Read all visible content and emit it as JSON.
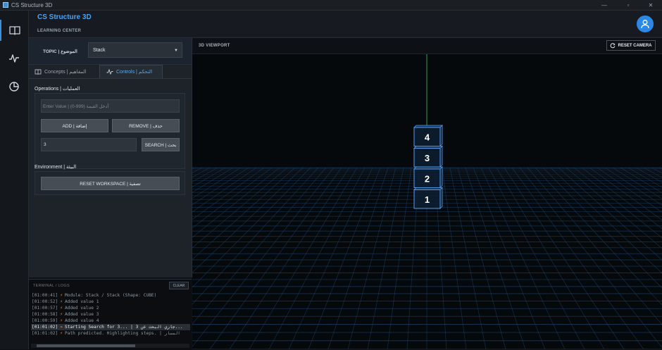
{
  "window": {
    "title": "CS Structure 3D"
  },
  "header": {
    "title": "CS Structure 3D",
    "subtitle": "LEARNING CENTER"
  },
  "rail": {
    "icons": [
      "book-icon",
      "pulse-icon",
      "pie-chart-icon"
    ]
  },
  "topic": {
    "label": "TOPIC | الموضوع",
    "selected": "Stack"
  },
  "tabs": [
    {
      "label": "Concepts | المفاهيم",
      "active": false
    },
    {
      "label": "Controls | التحكم",
      "active": true
    }
  ],
  "operations": {
    "title": "Operations | العمليات",
    "value_placeholder": "Enter Value | (0-999) أدخل القيمة",
    "add_label": "ADD | إضافة",
    "remove_label": "REMOVE | حذف",
    "search_value": "3",
    "search_label": "SEARCH | بحث"
  },
  "environment": {
    "title": "Environment | البيئة",
    "reset_label": "RESET WORKSPACE | تصفية"
  },
  "terminal": {
    "title": "TERMINAL / LOGS",
    "clear_label": "CLEAR",
    "logs": [
      {
        "time": "[01:00:41]",
        "icon": "⚡",
        "text": "Module: Stack / Stack (Shape: CUBE)"
      },
      {
        "time": "[01:00:52]",
        "icon": "⚡",
        "text": "Added value 1"
      },
      {
        "time": "[01:00:57]",
        "icon": "⚡",
        "text": "Added value 2"
      },
      {
        "time": "[01:00:58]",
        "icon": "⚡",
        "text": "Added value 3"
      },
      {
        "time": "[01:00:59]",
        "icon": "⚡",
        "text": "Added value 4"
      },
      {
        "time": "[01:01:02]",
        "icon": "»",
        "text": "Starting Search for 3... | 3 جاري البحث عن...",
        "highlight": true
      },
      {
        "time": "[01:01:02]",
        "icon": "⚡",
        "text": "Path predicted. Highlighting steps. | المسار"
      }
    ]
  },
  "viewport": {
    "title": "3D VIEWPORT",
    "reset_camera_label": "RESET CAMERA",
    "stack_values": [
      "4",
      "3",
      "2",
      "1"
    ],
    "accent_color": "#4f9df0"
  },
  "colors": {
    "accent": "#2c88e6",
    "brand": "#4aa3f0",
    "log_bolt": "#e8813a"
  }
}
